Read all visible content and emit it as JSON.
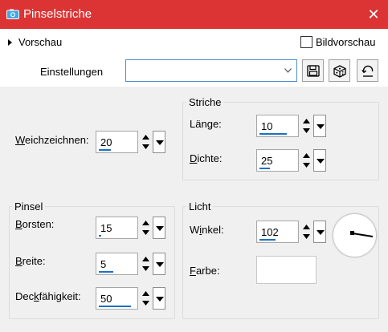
{
  "window": {
    "title": "Pinselstriche",
    "close_glyph": "✕",
    "icon": "camera-icon",
    "accent_color": "#dc3434"
  },
  "preview": {
    "label": "Vorschau",
    "checkbox_label": "Bildvorschau",
    "checked": false
  },
  "settings": {
    "label": "Einstellungen",
    "value": ""
  },
  "toolbar": {
    "icons": [
      "save-icon",
      "dice-icon",
      "reset-icon"
    ]
  },
  "soften": {
    "label": "Weichzeichnen:",
    "value": "20"
  },
  "strokes": {
    "title": "Striche",
    "length": {
      "label": "Länge:",
      "value": "10"
    },
    "density": {
      "label": "Dichte:",
      "value": "25"
    }
  },
  "brush": {
    "title": "Pinsel",
    "bristles": {
      "label": "Borsten:",
      "value": "15"
    },
    "width": {
      "label": "Breite:",
      "value": "5"
    },
    "opacity": {
      "label": "Deckfähigkeit:",
      "value": "50"
    }
  },
  "light": {
    "title": "Licht",
    "angle": {
      "label": "Winkel:",
      "value": "102"
    },
    "color": {
      "label": "Farbe:",
      "value": "#ffffff"
    }
  }
}
